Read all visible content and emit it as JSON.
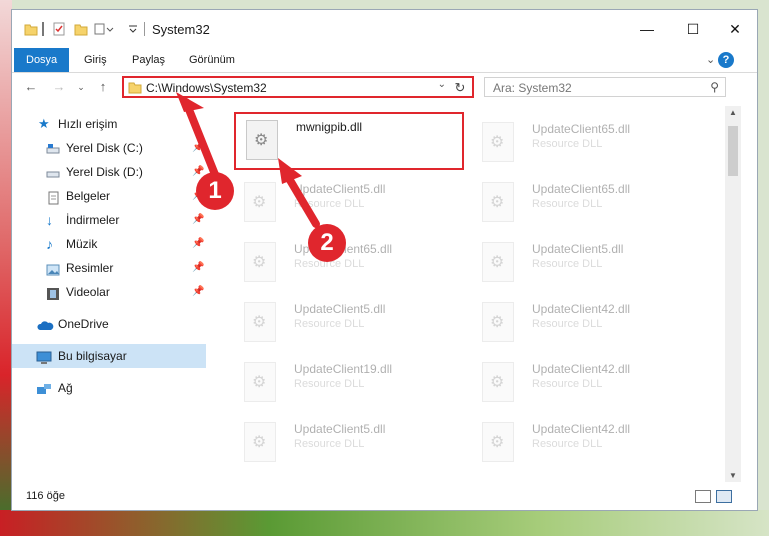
{
  "window": {
    "title": "System32"
  },
  "controls": {
    "minimize": "—",
    "maximize": "☐",
    "close": "✕"
  },
  "ribbon": {
    "tabs": [
      "Dosya",
      "Giriş",
      "Paylaş",
      "Görünüm"
    ],
    "help": "?"
  },
  "address": {
    "path": "C:\\Windows\\System32"
  },
  "search": {
    "placeholder": "Ara: System32"
  },
  "sidebar": {
    "items": [
      {
        "label": "Hızlı erişim",
        "icon": "star-icon",
        "pinned": false
      },
      {
        "label": "Yerel Disk (C:)",
        "icon": "drive-icon",
        "pinned": true
      },
      {
        "label": "Yerel Disk (D:)",
        "icon": "drive-icon",
        "pinned": true
      },
      {
        "label": "Belgeler",
        "icon": "documents-icon",
        "pinned": true
      },
      {
        "label": "İndirmeler",
        "icon": "download-icon",
        "pinned": true
      },
      {
        "label": "Müzik",
        "icon": "music-icon",
        "pinned": true
      },
      {
        "label": "Resimler",
        "icon": "pictures-icon",
        "pinned": true
      },
      {
        "label": "Videolar",
        "icon": "video-icon",
        "pinned": true
      },
      {
        "label": "OneDrive",
        "icon": "cloud-icon",
        "pinned": false
      },
      {
        "label": "Bu bilgisayar",
        "icon": "computer-icon",
        "pinned": false
      },
      {
        "label": "Ağ",
        "icon": "network-icon",
        "pinned": false
      }
    ]
  },
  "files": {
    "left": [
      {
        "name": "mwnigpib.dll",
        "type": ""
      },
      {
        "name": "UpdateClient5.dll",
        "type": "Resource DLL"
      },
      {
        "name": "UpdateClient65.dll",
        "type": "Resource DLL"
      },
      {
        "name": "UpdateClient5.dll",
        "type": "Resource DLL"
      },
      {
        "name": "UpdateClient19.dll",
        "type": "Resource DLL"
      },
      {
        "name": "UpdateClient5.dll",
        "type": "Resource DLL"
      }
    ],
    "right": [
      {
        "name": "UpdateClient65.dll",
        "type": "Resource DLL"
      },
      {
        "name": "UpdateClient65.dll",
        "type": "Resource DLL"
      },
      {
        "name": "UpdateClient5.dll",
        "type": "Resource DLL"
      },
      {
        "name": "UpdateClient42.dll",
        "type": "Resource DLL"
      },
      {
        "name": "UpdateClient42.dll",
        "type": "Resource DLL"
      },
      {
        "name": "UpdateClient42.dll",
        "type": "Resource DLL"
      }
    ]
  },
  "status": {
    "count": "116 öğe"
  },
  "annotations": {
    "step1": "1",
    "step2": "2"
  },
  "colors": {
    "accent": "#1979ca",
    "highlight": "#e0262d",
    "selected": "#cce3f6"
  }
}
